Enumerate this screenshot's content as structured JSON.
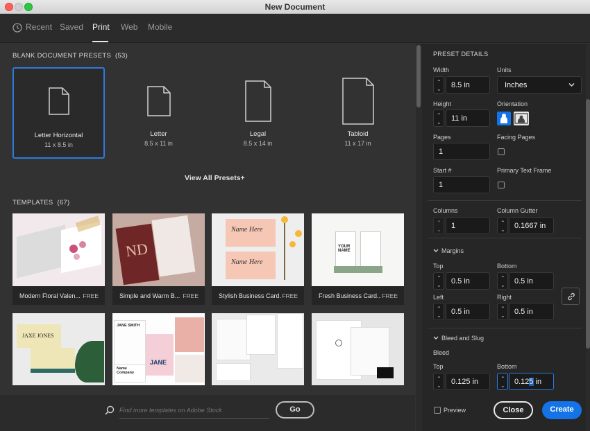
{
  "window": {
    "title": "New Document"
  },
  "tabs": [
    {
      "label": "Recent"
    },
    {
      "label": "Saved"
    },
    {
      "label": "Print"
    },
    {
      "label": "Web"
    },
    {
      "label": "Mobile"
    }
  ],
  "presets_section": {
    "title": "BLANK DOCUMENT PRESETS",
    "count": "(53)"
  },
  "presets": [
    {
      "name": "Letter Horizontal",
      "size": "11 x 8.5 in"
    },
    {
      "name": "Letter",
      "size": "8.5 x 11 in"
    },
    {
      "name": "Legal",
      "size": "8.5 x 14 in"
    },
    {
      "name": "Tabloid",
      "size": "11 x 17 in"
    }
  ],
  "view_all": "View All Presets",
  "view_all_plus": "+",
  "templates_section": {
    "title": "TEMPLATES",
    "count": "(67)"
  },
  "templates": [
    {
      "name": "Modern Floral Valen...",
      "badge": "FREE"
    },
    {
      "name": "Simple and Warm B...",
      "badge": "FREE"
    },
    {
      "name": "Stylish Business Card...",
      "badge": "FREE"
    },
    {
      "name": "Fresh Business Card...",
      "badge": "FREE"
    }
  ],
  "template_art": {
    "jaxe_jones": "JAXE JONES",
    "nd": "ND",
    "name_here": "Name Here",
    "your_name": "YOUR NAME",
    "jane_smith": "JANE SMITH",
    "name_company": "Name Company",
    "jane": "JANE"
  },
  "search": {
    "placeholder": "Find more templates on Adobe Stock",
    "go_label": "Go"
  },
  "details": {
    "title": "PRESET DETAILS",
    "width": {
      "label": "Width",
      "value": "8.5 in"
    },
    "units": {
      "label": "Units",
      "value": "Inches"
    },
    "height": {
      "label": "Height",
      "value": "11 in"
    },
    "orientation": {
      "label": "Orientation",
      "selected": "portrait"
    },
    "pages": {
      "label": "Pages",
      "value": "1"
    },
    "facing_pages": {
      "label": "Facing Pages",
      "checked": false
    },
    "start": {
      "label": "Start #",
      "value": "1"
    },
    "primary_text_frame": {
      "label": "Primary Text Frame",
      "checked": false
    },
    "columns": {
      "label": "Columns",
      "value": "1"
    },
    "column_gutter": {
      "label": "Column Gutter",
      "value": "0.1667 in"
    },
    "margins": {
      "label": "Margins",
      "top": {
        "label": "Top",
        "value": "0.5 in"
      },
      "bottom": {
        "label": "Bottom",
        "value": "0.5 in"
      },
      "left": {
        "label": "Left",
        "value": "0.5 in"
      },
      "right": {
        "label": "Right",
        "value": "0.5 in"
      }
    },
    "bleed_slug": {
      "label": "Bleed and Slug",
      "bleed_label": "Bleed",
      "top": {
        "label": "Top",
        "value": "0.125 in"
      },
      "bottom": {
        "label": "Bottom",
        "value_before": "0.12",
        "value_sel": "5",
        "value_after": " in"
      }
    },
    "preview": {
      "label": "Preview",
      "checked": false
    }
  },
  "buttons": {
    "close": "Close",
    "create": "Create"
  },
  "colors": {
    "accent": "#1473e6",
    "selection": "#2d7be0",
    "background": "#323232"
  }
}
